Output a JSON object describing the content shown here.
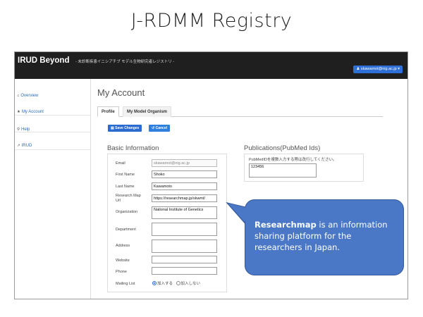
{
  "slide": {
    "title": "J-RDMM Registry"
  },
  "app": {
    "brand": "IRUD Beyond",
    "brand_subtitle": "- 未診断疾患イニシアチブ モデル生物研究者レジストリ -",
    "user_menu": "skawamot@nig.ac.jp"
  },
  "sidebar": {
    "items": [
      {
        "label": "Overview",
        "icon": "house-icon"
      },
      {
        "label": "My Account",
        "icon": "star-icon"
      },
      {
        "label": "Help",
        "icon": "location-pin-icon"
      },
      {
        "label": "IRUD",
        "icon": "external-link-icon"
      }
    ]
  },
  "page": {
    "title": "My Account",
    "tabs": [
      {
        "label": "Profile",
        "active": true
      },
      {
        "label": "My Model Organism",
        "active": false
      }
    ],
    "save_label": "Save Changes",
    "cancel_label": "Cancel"
  },
  "basic_info": {
    "title": "Basic Information",
    "fields": {
      "email": {
        "label": "Email",
        "value": "skawamot@nig.ac.jp"
      },
      "first_name": {
        "label": "First Name",
        "value": "Shoko"
      },
      "last_name": {
        "label": "Last Name",
        "value": "Kawamoto"
      },
      "research_map": {
        "label_line1": "Research Map",
        "label_line2": "Url",
        "value": "https://researchmap.jp/skwmt/"
      },
      "organization": {
        "label": "Organization",
        "value": "National Institute of Genetics"
      },
      "department": {
        "label": "Department",
        "value": ""
      },
      "address": {
        "label": "Address",
        "value": ""
      },
      "website": {
        "label": "Website",
        "value": ""
      },
      "phone": {
        "label": "Phone",
        "value": ""
      },
      "mailing_list": {
        "label": "Mailing List",
        "options": [
          "加入する",
          "加入しない"
        ],
        "selected": "加入する"
      }
    }
  },
  "publications": {
    "title": "Publications(PubMed Ids)",
    "hint": "PubMedIDを複数入力する際は改行してください。",
    "value": "123456"
  },
  "callout": {
    "bold": "Researchmap",
    "text": " is an information sharing platform for the researchers in Japan.",
    "color": "#4a78c6"
  },
  "colors": {
    "topbar": "#1f1f1f",
    "accent": "#2a6bd1",
    "link": "#2a6bb8"
  }
}
